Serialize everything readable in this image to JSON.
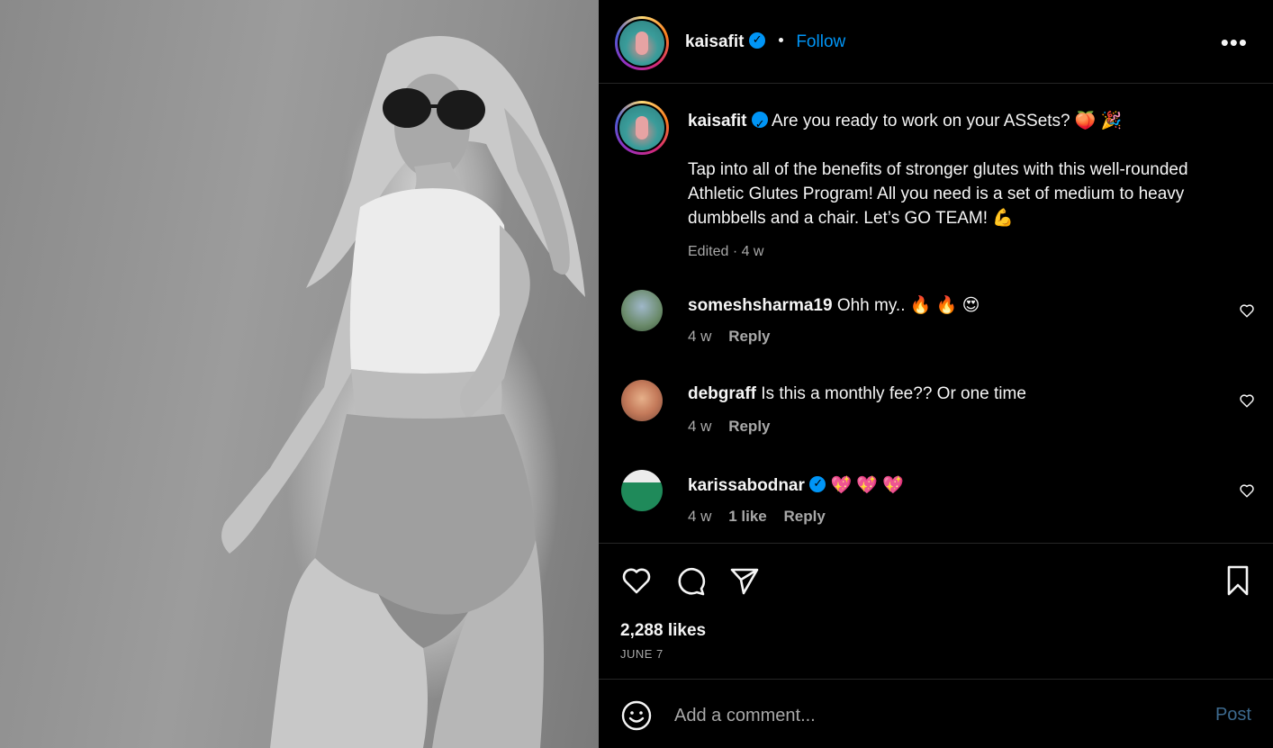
{
  "post": {
    "author": "kaisafit",
    "follow_label": "Follow",
    "more_label": "•••",
    "photo_alt": "Black and white photo of woman in sunglasses, white crop top and denim shorts"
  },
  "caption": {
    "username": "kaisafit",
    "line1": "Are you ready to work on your ASSets? 🍑 🎉",
    "body": "Tap into all of the benefits of stronger glutes with this well-rounded Athletic Glutes Program! All you need is a set of medium to heavy dumbbells and a chair. Let’s GO TEAM! 💪",
    "meta": "Edited · 4 w"
  },
  "comments": [
    {
      "username": "someshsharma19",
      "text": "Ohh my.. 🔥 🔥 😍",
      "time": "4 w",
      "likes": "",
      "reply": "Reply"
    },
    {
      "username": "debgraff",
      "text": "Is this a monthly fee?? Or one time",
      "time": "4 w",
      "likes": "",
      "reply": "Reply"
    },
    {
      "username": "karissabodnar",
      "text": "💖 💖 💖",
      "time": "4 w",
      "likes": "1 like",
      "reply": "Reply"
    }
  ],
  "stats": {
    "likes": "2,288 likes",
    "date": "JUNE 7"
  },
  "composer": {
    "placeholder": "Add a comment...",
    "post_label": "Post"
  },
  "icons": {
    "like": "heart-icon",
    "comment": "comment-bubble-icon",
    "share": "paper-plane-icon",
    "save": "bookmark-icon",
    "emoji": "smiley-icon",
    "verified": "verified-badge-icon"
  },
  "colors": {
    "accent": "#0095f6",
    "muted": "#a8a8a8",
    "background": "#000000",
    "divider": "#262626"
  }
}
